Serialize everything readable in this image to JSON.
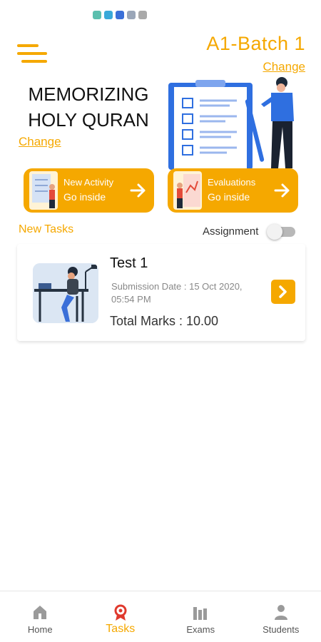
{
  "header": {
    "batch_name": "A1-Batch 1",
    "batch_change_label": "Change"
  },
  "course": {
    "title": "MEMORIZING HOLY QURAN",
    "change_label": "Change"
  },
  "cards": [
    {
      "title": "New Activity",
      "action": "Go inside"
    },
    {
      "title": "Evaluations",
      "action": "Go inside"
    }
  ],
  "tasks_section": {
    "heading": "New Tasks",
    "filter_label": "Assignment",
    "filter_enabled": false
  },
  "tasks": [
    {
      "name": "Test 1",
      "submission_date": "Submission Date : 15 Oct 2020, 05:54 PM",
      "total_marks": "Total Marks : 10.00"
    }
  ],
  "bottom_nav": [
    {
      "label": "Home",
      "icon": "home-icon",
      "active": false
    },
    {
      "label": "Tasks",
      "icon": "tasks-icon",
      "active": true
    },
    {
      "label": "Exams",
      "icon": "exams-icon",
      "active": false
    },
    {
      "label": "Students",
      "icon": "students-icon",
      "active": false
    }
  ],
  "colors": {
    "accent": "#f5a800",
    "illustration_blue": "#2f6fe0",
    "text": "#111111"
  }
}
